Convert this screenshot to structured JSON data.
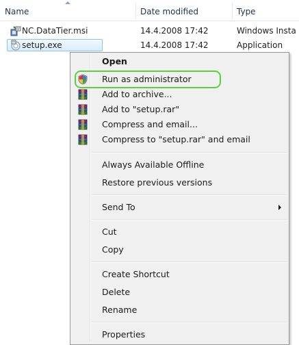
{
  "file_list": {
    "columns": {
      "name": "Name",
      "date_modified": "Date modified",
      "type": "Type"
    },
    "rows": [
      {
        "name": "NC.DataTier.msi",
        "date_modified": "14.4.2008 17:42",
        "type": "Windows Insta",
        "icon": "msi-installer-icon"
      },
      {
        "name": "setup.exe",
        "date_modified": "14.4.2008 17:42",
        "type": "Application",
        "icon": "setup-exe-icon"
      }
    ]
  },
  "context_menu": {
    "open": "Open",
    "run_as_admin": "Run as administrator",
    "add_to_archive": "Add to archive...",
    "add_to_setup_rar": "Add to \"setup.rar\"",
    "compress_and_email": "Compress and email...",
    "compress_to_rar_and_email": "Compress to \"setup.rar\" and email",
    "always_available_offline": "Always Available Offline",
    "restore_previous_versions": "Restore previous versions",
    "send_to": "Send To",
    "cut": "Cut",
    "copy": "Copy",
    "create_shortcut": "Create Shortcut",
    "delete": "Delete",
    "rename": "Rename",
    "properties": "Properties"
  },
  "colors": {
    "highlight_ring": "#5ad13a",
    "menu_background": "#f0f0f0",
    "selection_border": "#8cc4f0"
  }
}
